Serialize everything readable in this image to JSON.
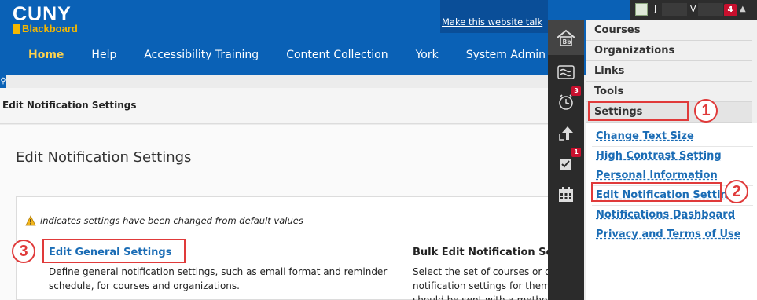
{
  "header": {
    "logo_top": "CUNY",
    "logo_bottom": "Blackboard",
    "talk_link": "Make this website talk",
    "nav": [
      "Home",
      "Help",
      "Accessibility Training",
      "Content Collection",
      "York",
      "System Admin"
    ]
  },
  "user": {
    "initial_first": "J",
    "initial_last": "V",
    "notification_count": "4"
  },
  "page": {
    "bar_title": "Edit Notification Settings",
    "title": "Edit Notification Settings",
    "warning_text": "indicates settings have been changed from default values",
    "general_link": "Edit General Settings",
    "general_desc": "Define general notification settings, such as email format and reminder schedule, for courses and organizations.",
    "bulk_title": "Bulk Edit Notification Settings",
    "bulk_desc_1": "Select the set of courses or organizations",
    "bulk_desc_2": "notification settings for them",
    "bulk_desc_3": "should be sent with a method"
  },
  "rail": {
    "badge_calendar": "3",
    "badge_grades": "1",
    "icons": [
      "blackboard-home-icon",
      "stream-icon",
      "calendar-clock-icon",
      "updates-icon",
      "grades-icon",
      "calendar-grid-icon"
    ]
  },
  "menu": {
    "items": [
      "Courses",
      "Organizations",
      "Links",
      "Tools",
      "Settings"
    ],
    "sub_items": [
      "Change Text Size",
      "High Contrast Setting",
      "Personal Information",
      "Edit Notification Settings",
      "Notifications Dashboard",
      "Privacy and Terms of Use"
    ]
  },
  "callouts": [
    "1",
    "2",
    "3"
  ],
  "colors": {
    "header": "#0a61b6",
    "nav_active": "#ffd24c",
    "link": "#1a6cb5",
    "callout": "#e03a3a",
    "badge": "#c8102e"
  }
}
